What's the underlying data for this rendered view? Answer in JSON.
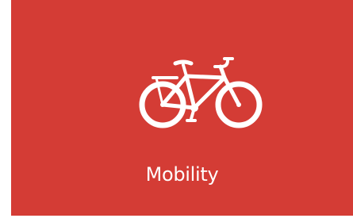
{
  "tile": {
    "label": "Mobility",
    "icon": "bicycle-icon",
    "background_color": "#d43c35",
    "text_color": "#ffffff"
  }
}
